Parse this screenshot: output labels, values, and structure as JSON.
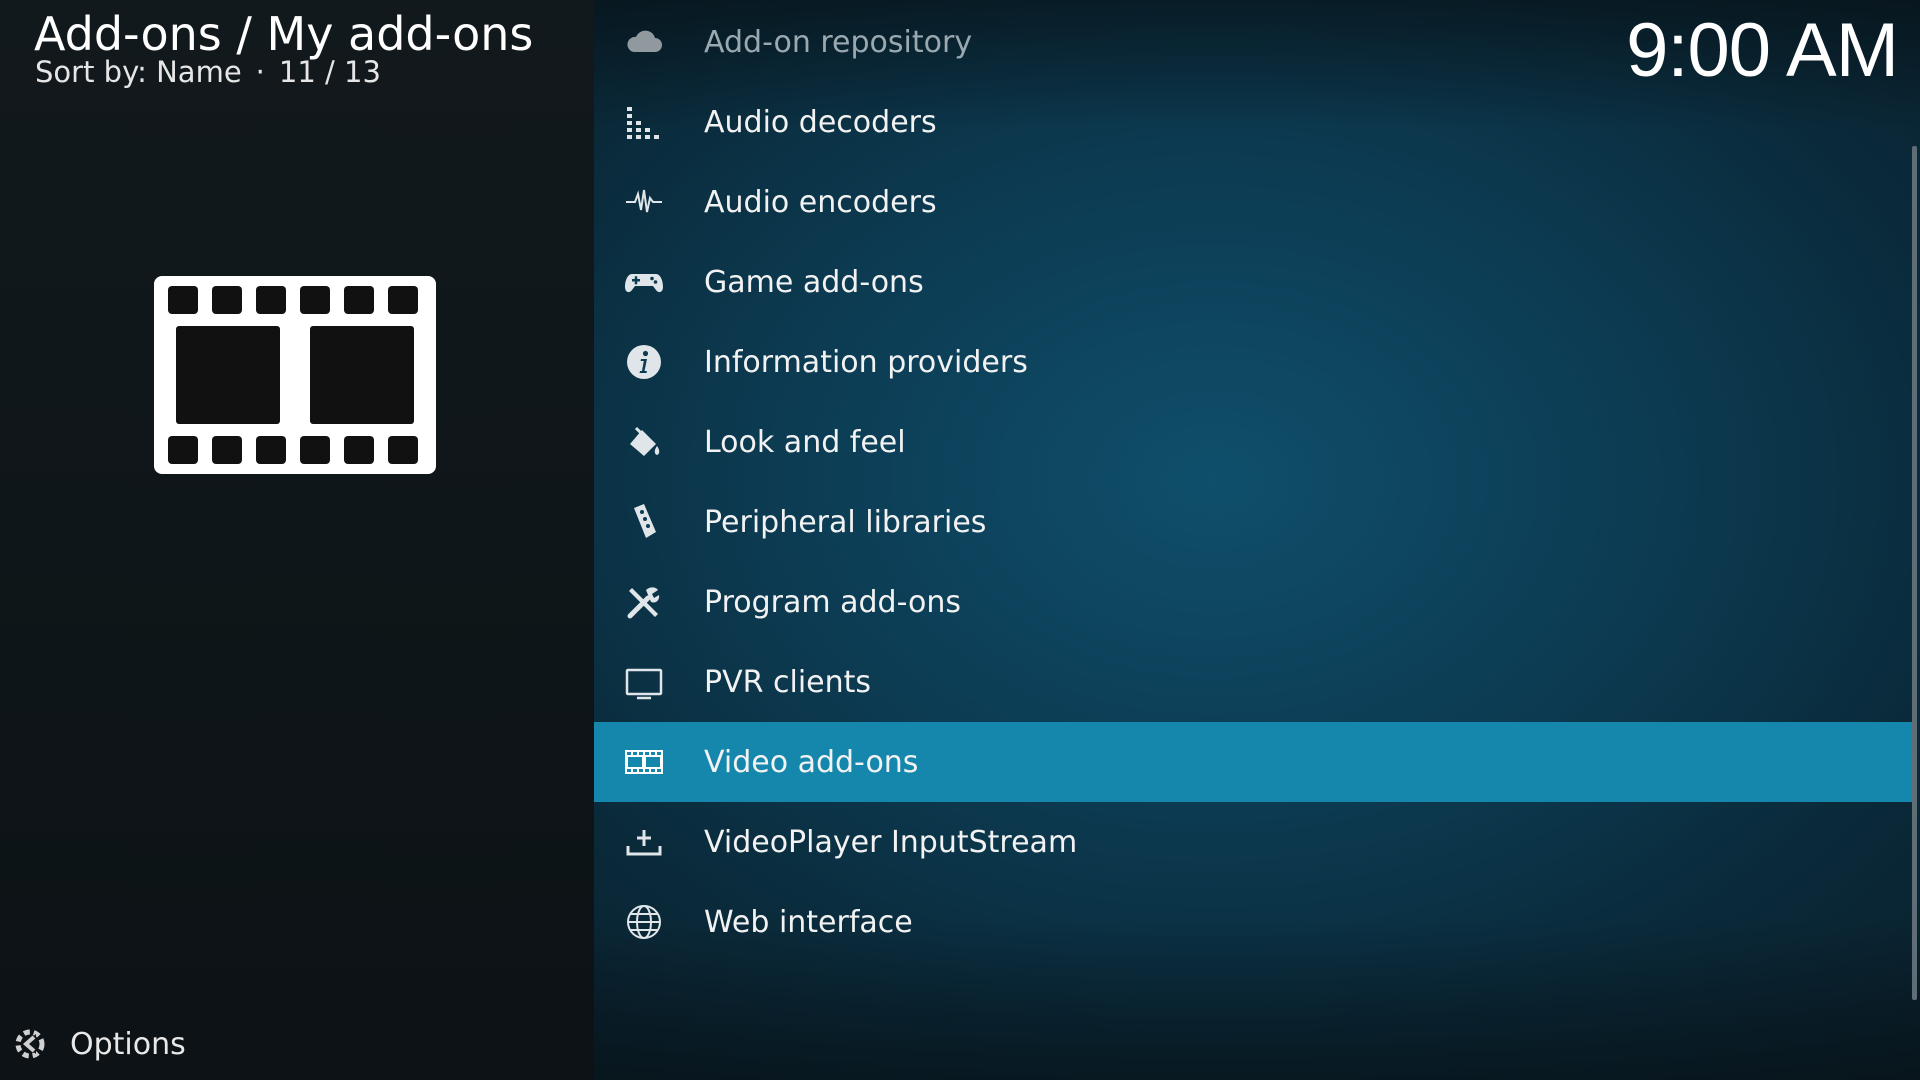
{
  "header": {
    "title": "Add-ons / My add-ons",
    "sort_label": "Sort by: Name",
    "separator": "·",
    "position": "11 / 13"
  },
  "clock": "9:00 AM",
  "preview": {
    "icon": "film-strip-icon"
  },
  "options": {
    "label": "Options",
    "icon": "options-icon"
  },
  "list": {
    "items": [
      {
        "label": "Add-on repository",
        "icon": "cloud-icon",
        "state": "dim"
      },
      {
        "label": "Audio decoders",
        "icon": "equalizer-icon"
      },
      {
        "label": "Audio encoders",
        "icon": "waveform-icon"
      },
      {
        "label": "Game add-ons",
        "icon": "gamepad-icon"
      },
      {
        "label": "Information providers",
        "icon": "info-icon"
      },
      {
        "label": "Look and feel",
        "icon": "paint-bucket-icon"
      },
      {
        "label": "Peripheral libraries",
        "icon": "remote-control-icon"
      },
      {
        "label": "Program add-ons",
        "icon": "tools-icon"
      },
      {
        "label": "PVR clients",
        "icon": "tv-icon"
      },
      {
        "label": "Video add-ons",
        "icon": "film-strip-icon",
        "state": "selected"
      },
      {
        "label": "VideoPlayer InputStream",
        "icon": "input-tray-icon"
      },
      {
        "label": "Web interface",
        "icon": "globe-icon"
      }
    ]
  },
  "colors": {
    "selected_row": "#1587ad",
    "list_background": "#0c3b52",
    "left_background": "#0f1619"
  }
}
